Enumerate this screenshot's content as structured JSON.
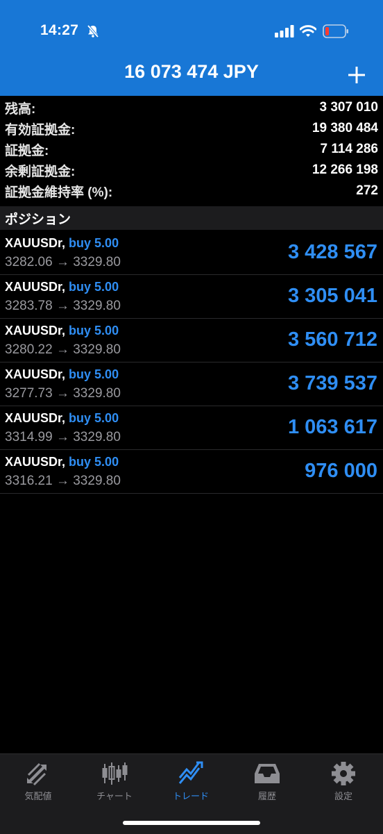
{
  "status_bar": {
    "time": "14:27",
    "bell_icon": "bell-slash-icon",
    "signal_icon": "cellular-signal-icon",
    "wifi_icon": "wifi-icon",
    "battery_icon": "battery-low-icon"
  },
  "header": {
    "title": "16 073 474 JPY",
    "add_icon": "plus-icon"
  },
  "summary": [
    {
      "label": "残高:",
      "value": "3 307 010"
    },
    {
      "label": "有効証拠金:",
      "value": "19 380 484"
    },
    {
      "label": "証拠金:",
      "value": "7 114 286"
    },
    {
      "label": "余剰証拠金:",
      "value": "12 266 198"
    },
    {
      "label": "証拠金維持率 (%):",
      "value": "272"
    }
  ],
  "positions_header": "ポジション",
  "positions": [
    {
      "symbol": "XAUUSDr,",
      "direction": "buy 5.00",
      "prices": "3282.06 → 3329.80",
      "profit": "3 428 567"
    },
    {
      "symbol": "XAUUSDr,",
      "direction": "buy 5.00",
      "prices": "3283.78 → 3329.80",
      "profit": "3 305 041"
    },
    {
      "symbol": "XAUUSDr,",
      "direction": "buy 5.00",
      "prices": "3280.22 → 3329.80",
      "profit": "3 560 712"
    },
    {
      "symbol": "XAUUSDr,",
      "direction": "buy 5.00",
      "prices": "3277.73 → 3329.80",
      "profit": "3 739 537"
    },
    {
      "symbol": "XAUUSDr,",
      "direction": "buy 5.00",
      "prices": "3314.99 → 3329.80",
      "profit": "1 063 617"
    },
    {
      "symbol": "XAUUSDr,",
      "direction": "buy 5.00",
      "prices": "3316.21 → 3329.80",
      "profit": "976 000"
    }
  ],
  "tabs": [
    {
      "label": "気配値",
      "icon": "quotes-arrows-icon"
    },
    {
      "label": "チャート",
      "icon": "candlestick-chart-icon"
    },
    {
      "label": "トレード",
      "icon": "trade-line-icon",
      "active": true
    },
    {
      "label": "履歴",
      "icon": "history-tray-icon"
    },
    {
      "label": "設定",
      "icon": "gear-icon"
    }
  ],
  "colors": {
    "header_bg": "#1877d6",
    "accent_blue": "#2f8ef4",
    "background": "#000000",
    "tabbar_bg": "#1c1c1e"
  }
}
